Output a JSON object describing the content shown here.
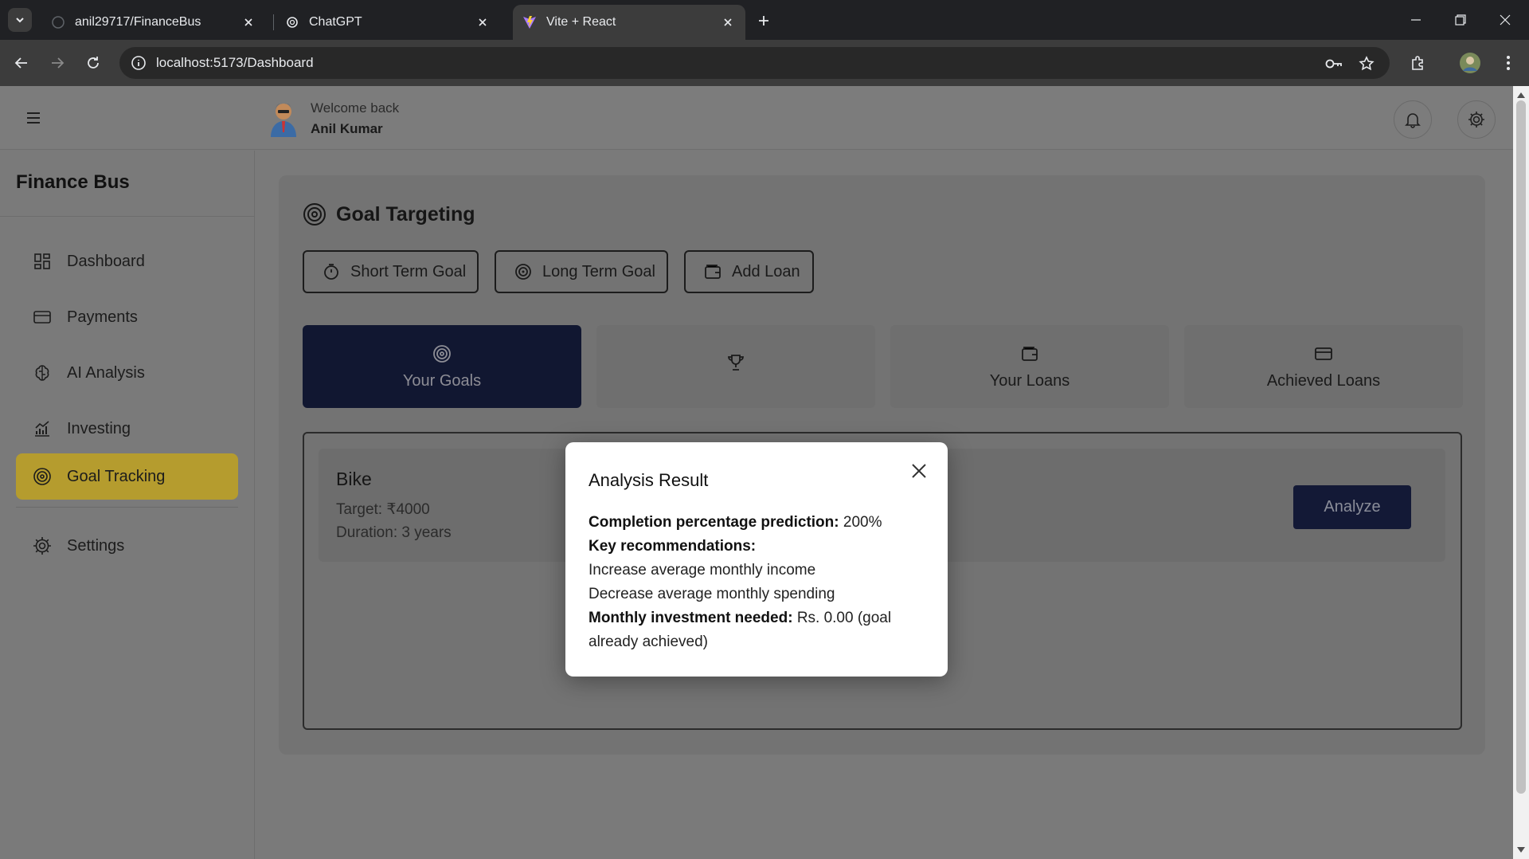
{
  "browser": {
    "tabs": [
      {
        "title": "anil29717/FinanceBus"
      },
      {
        "title": "ChatGPT"
      },
      {
        "title": "Vite + React"
      }
    ],
    "url": "localhost:5173/Dashboard"
  },
  "header": {
    "welcome": "Welcome back",
    "user_name": "Anil Kumar"
  },
  "sidebar": {
    "brand": "Finance Bus",
    "items": [
      {
        "label": "Dashboard",
        "icon": "dashboard-icon"
      },
      {
        "label": "Payments",
        "icon": "credit-card-icon"
      },
      {
        "label": "AI Analysis",
        "icon": "brain-icon"
      },
      {
        "label": "Investing",
        "icon": "chart-icon"
      },
      {
        "label": "Goal Tracking",
        "icon": "target-icon",
        "active": true
      },
      {
        "label": "Settings",
        "icon": "gear-icon"
      }
    ]
  },
  "main": {
    "title": "Goal Targeting",
    "actions": [
      "Short Term Goal",
      "Long Term Goal",
      "Add Loan"
    ],
    "tabs": [
      {
        "label": "Your Goals",
        "active": true
      },
      {
        "label": ""
      },
      {
        "label": "Your Loans"
      },
      {
        "label": "Achieved Loans"
      }
    ],
    "goal": {
      "name": "Bike",
      "target": "Target: ₹4000",
      "duration": "Duration: 3 years",
      "analyze_label": "Analyze"
    }
  },
  "modal": {
    "title": "Analysis Result",
    "completion_label": "Completion percentage prediction:",
    "completion_value": "200%",
    "recommendations_label": "Key recommendations:",
    "rec_1": "Increase average monthly income",
    "rec_2": "Decrease average monthly spending",
    "investment_label": "Monthly investment needed:",
    "investment_value": "Rs. 0.00 (goal already achieved)"
  },
  "colors": {
    "active_nav": "#b59c2e",
    "active_tab": "#111731",
    "analyze_button": "#131936"
  }
}
